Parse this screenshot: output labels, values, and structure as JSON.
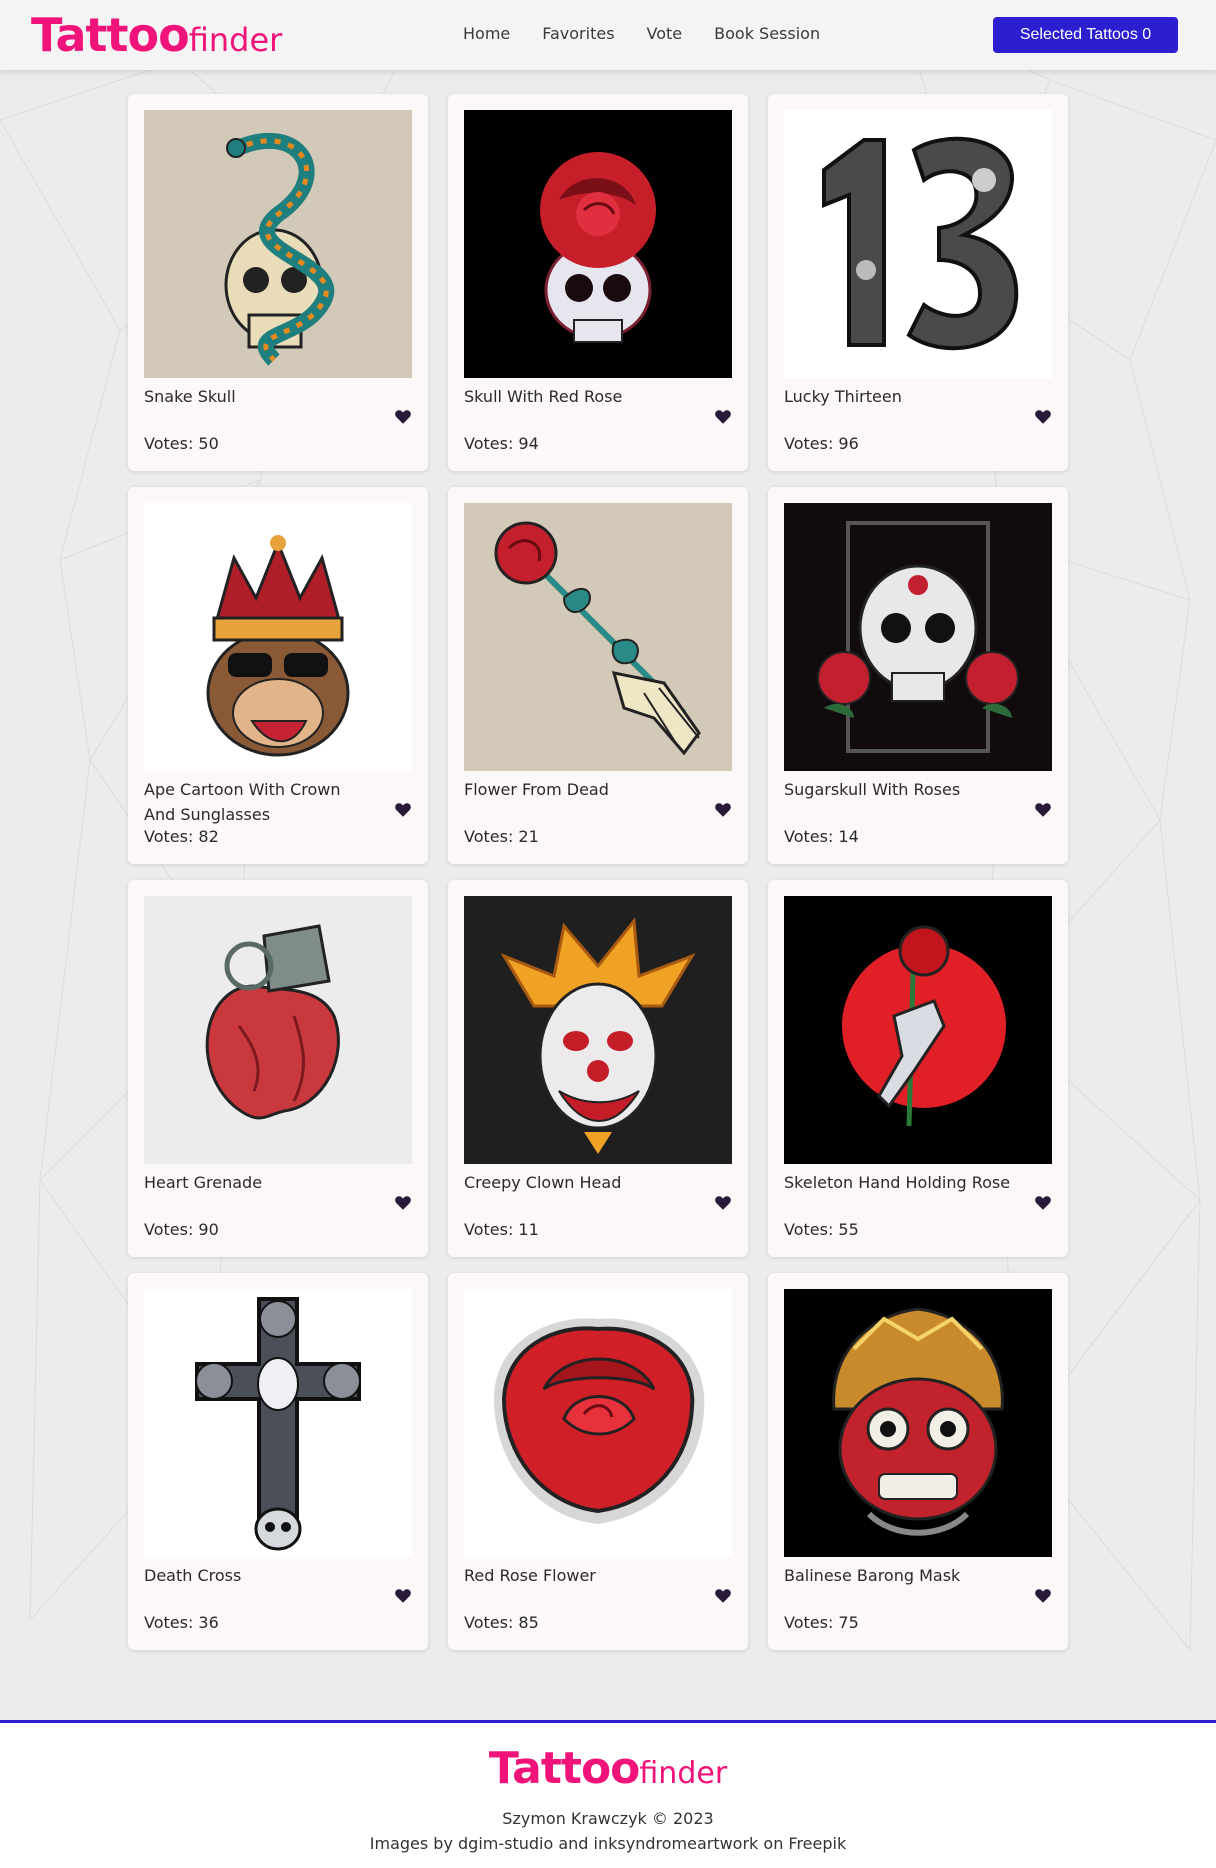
{
  "header": {
    "logo_main": "Tattoo",
    "logo_sub": "finder",
    "nav": [
      "Home",
      "Favorites",
      "Vote",
      "Book Session"
    ],
    "selected_button": "Selected Tattoos 0"
  },
  "cards": [
    {
      "title": "Snake Skull",
      "votes": "Votes: 50",
      "bg": "#d3c9b8"
    },
    {
      "title": "Skull With Red Rose",
      "votes": "Votes: 94",
      "bg": "#000000"
    },
    {
      "title": "Lucky Thirteen",
      "votes": "Votes: 96",
      "bg": "#ffffff"
    },
    {
      "title": "Ape Cartoon With Crown And Sunglasses",
      "votes": "Votes: 82",
      "bg": "#ffffff"
    },
    {
      "title": "Flower From Dead",
      "votes": "Votes: 21",
      "bg": "#d3c9b8"
    },
    {
      "title": "Sugarskull With Roses",
      "votes": "Votes: 14",
      "bg": "#110b0e"
    },
    {
      "title": "Heart Grenade",
      "votes": "Votes: 90",
      "bg": "#ececec"
    },
    {
      "title": "Creepy Clown Head",
      "votes": "Votes: 11",
      "bg": "#1f1f1f"
    },
    {
      "title": "Skeleton Hand Holding Rose",
      "votes": "Votes: 55",
      "bg": "#000000"
    },
    {
      "title": "Death Cross",
      "votes": "Votes: 36",
      "bg": "#ffffff"
    },
    {
      "title": "Red Rose Flower",
      "votes": "Votes: 85",
      "bg": "#ffffff"
    },
    {
      "title": "Balinese Barong Mask",
      "votes": "Votes: 75",
      "bg": "#000000"
    }
  ],
  "footer": {
    "logo_main": "Tattoo",
    "logo_sub": "finder",
    "author": "Szymon Krawczyk © 2023",
    "credits": "Images by dgim-studio and inksyndromeartwork on Freepik"
  },
  "colors": {
    "brand": "#f0137a",
    "accent": "#2b1fd0",
    "heart": "#2a1a3a"
  }
}
